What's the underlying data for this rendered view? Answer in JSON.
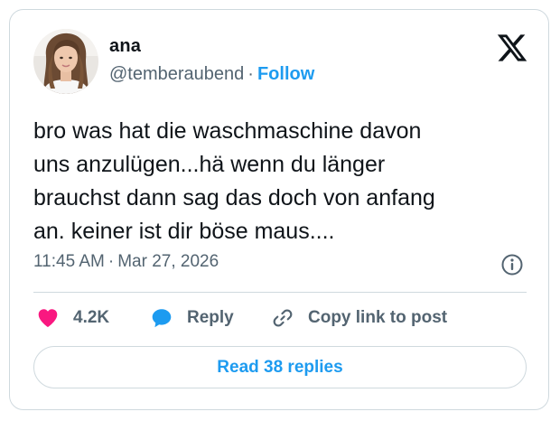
{
  "author": {
    "name": "ana",
    "handle": "@temberaubend",
    "separator": "·",
    "follow_label": "Follow"
  },
  "header": {
    "logo_icon": "x-logo-icon"
  },
  "tweet": {
    "lines": [
      "bro was hat die waschmaschine davon",
      "uns anzulügen...hä wenn du länger",
      "brauchst dann sag das doch von anfang",
      "an. keiner ist dir böse maus...."
    ],
    "time": "11:45 AM",
    "separator": "·",
    "date": "Mar 27, 2026",
    "info_icon": "info-icon"
  },
  "actions": {
    "like_icon": "heart-icon",
    "like_count": "4.2K",
    "reply_icon": "speech-bubble-icon",
    "reply_label": "Reply",
    "copy_icon": "link-icon",
    "copy_label": "Copy link to post"
  },
  "footer": {
    "read_replies_label": "Read 38 replies"
  },
  "colors": {
    "accent": "#1d9bf0",
    "like": "#f91880",
    "secondary_text": "#536471",
    "border": "#cfd9de"
  }
}
